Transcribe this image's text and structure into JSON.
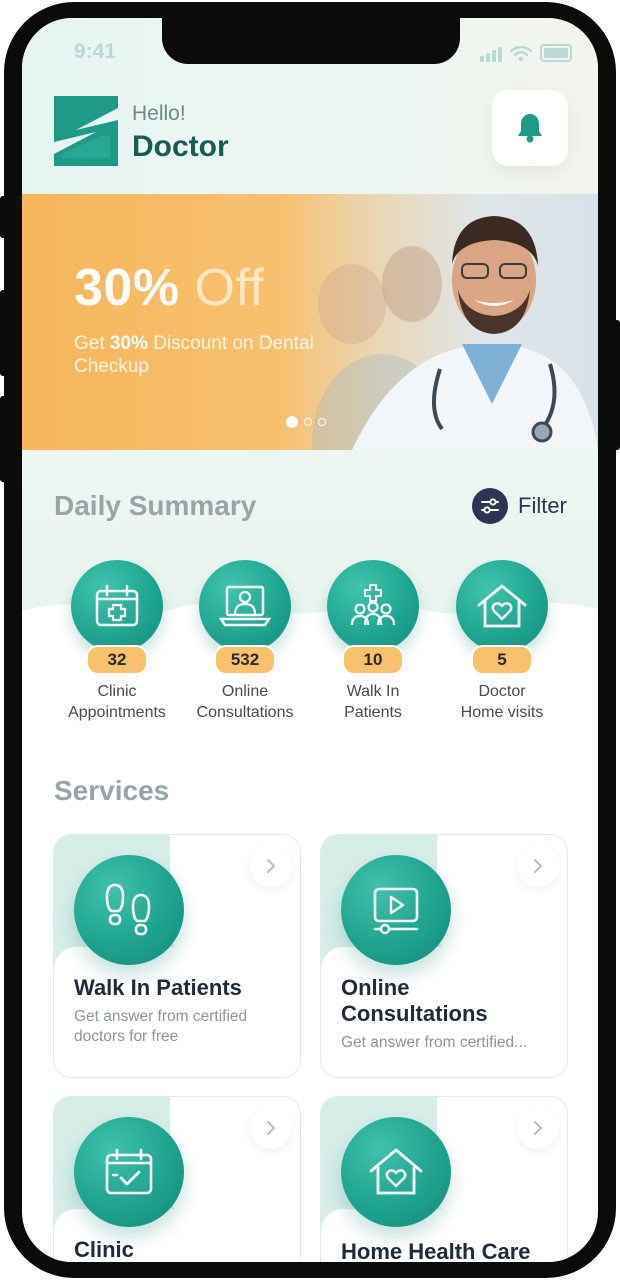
{
  "status": {
    "time": "9:41"
  },
  "header": {
    "greeting": "Hello!",
    "user_name": "Doctor"
  },
  "banner": {
    "discount": "30%",
    "off_word": "Off",
    "sub_prefix": "Get ",
    "sub_bold": "30%",
    "sub_suffix": " Discount on Dental Checkup",
    "slide_index": 1,
    "slide_count": 3
  },
  "daily_summary": {
    "title": "Daily Summary",
    "filter_label": "Filter",
    "stats": [
      {
        "value": "32",
        "label_line1": "Clinic",
        "label_line2": "Appointments",
        "icon": "calendar-plus-icon"
      },
      {
        "value": "532",
        "label_line1": "Online",
        "label_line2": "Consultations",
        "icon": "doctor-laptop-icon"
      },
      {
        "value": "10",
        "label_line1": "Walk In",
        "label_line2": "Patients",
        "icon": "people-cross-icon"
      },
      {
        "value": "5",
        "label_line1": "Doctor",
        "label_line2": "Home visits",
        "icon": "home-heart-icon"
      }
    ]
  },
  "services": {
    "title": "Services",
    "cards": [
      {
        "title_line1": "Walk In Patients",
        "title_line2": "",
        "desc_line1": "Get answer from certified",
        "desc_line2": "doctors for free",
        "icon": "footprints-icon"
      },
      {
        "title_line1": "Online",
        "title_line2": "Consultations",
        "desc_line1": "Get answer from certified...",
        "desc_line2": "",
        "icon": "video-play-icon"
      },
      {
        "title_line1": "Clinic",
        "title_line2": "",
        "desc_line1": "",
        "desc_line2": "",
        "icon": "calendar-check-icon"
      },
      {
        "title_line1": "Home Health Care",
        "title_line2": "",
        "desc_line1": "",
        "desc_line2": "",
        "icon": "home-heart-icon"
      }
    ]
  },
  "colors": {
    "accent": "#1fa591",
    "badge": "#f8c26b",
    "banner_orange": "#f6b65a",
    "navy": "#2d3554"
  }
}
